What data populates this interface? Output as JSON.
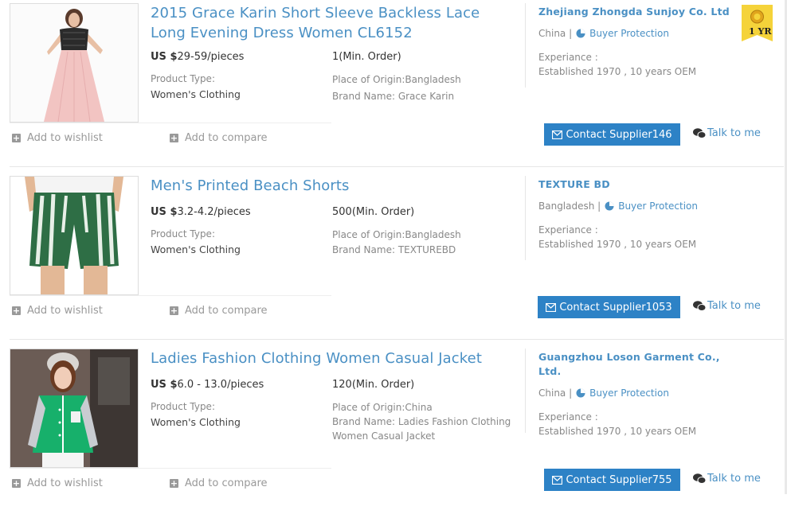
{
  "listings": [
    {
      "title": "2015 Grace Karin Short Sleeve Backless Lace Long Evening Dress Women CL6152",
      "price_prefix": "US $",
      "price_range": "29-59/pieces",
      "min_order": "1(Min. Order)",
      "product_type_label": "Product Type:",
      "product_type": "Women's Clothing",
      "place_of_origin": "Place of Origin:Bangladesh",
      "brand_name": "Brand Name: Grace Karin",
      "wishlist": "Add to wishlist",
      "compare": "Add to compare",
      "supplier": {
        "name": "Zhejiang Zhongda Sunjoy Co. Ltd",
        "country": "China |",
        "buyer_protection": "Buyer Protection",
        "experience_label": "Experiance :",
        "experience_value": "Established 1970 , 10 years OEM",
        "badge": "1 YR"
      },
      "contact_label": "Contact Supplier146",
      "talk_label": "Talk to me"
    },
    {
      "title": "Men's Printed Beach Shorts",
      "price_prefix": "US $",
      "price_range": "3.2-4.2/pieces",
      "min_order": "500(Min. Order)",
      "product_type_label": "Product Type:",
      "product_type": "Women's Clothing",
      "place_of_origin": "Place of Origin:Bangladesh",
      "brand_name": "Brand Name: TEXTUREBD",
      "wishlist": "Add to wishlist",
      "compare": "Add to compare",
      "supplier": {
        "name": "TEXTURE BD",
        "country": "Bangladesh |",
        "buyer_protection": "Buyer Protection",
        "experience_label": "Experiance :",
        "experience_value": "Established 1970 , 10 years OEM"
      },
      "contact_label": "Contact Supplier1053",
      "talk_label": "Talk to me"
    },
    {
      "title": "Ladies Fashion Clothing Women Casual Jacket",
      "price_prefix": "US $",
      "price_range": "6.0 - 13.0/pieces",
      "min_order": "120(Min. Order)",
      "product_type_label": "Product Type:",
      "product_type": "Women's Clothing",
      "place_of_origin": "Place of Origin:China",
      "brand_name": "Brand Name: Ladies Fashion Clothing Women Casual Jacket",
      "wishlist": "Add to wishlist",
      "compare": "Add to compare",
      "supplier": {
        "name": "Guangzhou Loson Garment Co., Ltd.",
        "country": "China |",
        "buyer_protection": "Buyer Protection",
        "experience_label": "Experiance :",
        "experience_value": "Established 1970 , 10 years OEM"
      },
      "contact_label": "Contact Supplier755",
      "talk_label": "Talk to me"
    }
  ],
  "colors": {
    "link_blue": "#4a90c4",
    "button_blue": "#2d82c6",
    "muted_text": "#888888",
    "badge_yellow": "#f5d33a"
  },
  "icons": [
    "plus-square-icon",
    "pie-chart-icon",
    "envelope-icon",
    "wechat-icon",
    "gold-supplier-badge-icon"
  ]
}
